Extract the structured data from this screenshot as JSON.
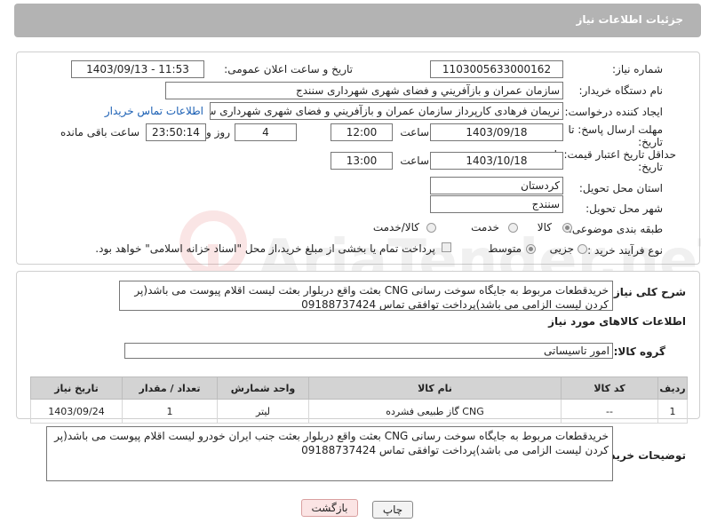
{
  "header": {
    "title": "جزئیات اطلاعات نیاز"
  },
  "form": {
    "need_number_label": "شماره نیاز:",
    "need_number": "1103005633000162",
    "announce_label": "تاریخ و ساعت اعلان عمومی:",
    "announce_value": "1403/09/13 - 11:53",
    "buyer_org_label": "نام دستگاه خریدار:",
    "buyer_org": "سازمان عمران و بازآفريني و فضای شهری شهرداری سنندج",
    "requester_label": "ایجاد کننده درخواست:",
    "requester": "نریمان فرهادی کارپرداز سازمان عمران و بازآفريني و فضای شهری شهرداری سنندج",
    "contact_link": "اطلاعات تماس خریدار",
    "deadline_label": "مهلت ارسال پاسخ: تا تاریخ:",
    "deadline_date": "1403/09/18",
    "time_label": "ساعت",
    "deadline_time": "12:00",
    "days_value": "4",
    "days_label": "روز و",
    "remaining_time": "23:50:14",
    "remaining_label": "ساعت باقی مانده",
    "validity_label": "حداقل تاریخ اعتبار قیمت: تا تاریخ:",
    "validity_date": "1403/10/18",
    "validity_time": "13:00",
    "province_label": "استان محل تحویل:",
    "province": "کردستان",
    "city_label": "شهر محل تحویل:",
    "city": "سنندج",
    "category_label": "طبقه بندی موضوعی:",
    "category_options": [
      "کالا",
      "خدمت",
      "کالا/خدمت"
    ],
    "process_label": "نوع فرآیند خرید :",
    "process_options": [
      "جزیی",
      "متوسط"
    ],
    "process_note": "پرداخت تمام یا بخشی از مبلغ خرید،از محل \"اسناد خزانه اسلامی\" خواهد بود."
  },
  "description": {
    "label": "شرح کلی نیاز:",
    "text": "خریدقطعات مربوط به جایگاه سوخت رسانی CNG بعثت واقع دربلوار بعثت لیست اقلام پیوست می باشد(پر کردن لیست الزامی می باشد)پرداخت توافقی تماس 09188737424"
  },
  "goods": {
    "section_title": "اطلاعات کالاهای مورد نیاز",
    "group_label": "گروه کالا:",
    "group_value": "امور تاسیساتی",
    "columns": [
      "ردیف",
      "کد کالا",
      "نام کالا",
      "واحد شمارش",
      "تعداد / مقدار",
      "تاریخ نیاز"
    ],
    "rows": [
      {
        "row": "1",
        "code": "--",
        "name": "گاز طبیعی فشرده CNG",
        "unit": "لیتر",
        "qty": "1",
        "date": "1403/09/24"
      }
    ]
  },
  "buyer_notes": {
    "label": "توضیحات خریدار:",
    "text": "خریدقطعات مربوط به جایگاه سوخت رسانی CNG بعثت واقع دربلوار بعثت  جنب ایران خودرو لیست اقلام پیوست می باشد(پر کردن لیست الزامی می باشد)پرداخت توافقی تماس 09188737424"
  },
  "buttons": {
    "print": "چاپ",
    "back": "بازگشت"
  },
  "watermark": {
    "text": "AriaTender.neT"
  }
}
